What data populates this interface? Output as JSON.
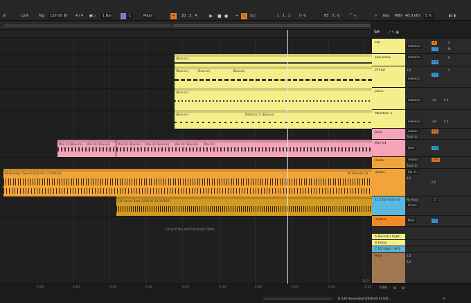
{
  "transport": {
    "link": "Link",
    "tap": "Tap",
    "tempo": "120.00",
    "signature": "4 / 4",
    "quantize": "1 Bar",
    "key": "C",
    "scale": "Major",
    "bar_pos": "20 .  3 .  4",
    "loop_start": "1 .  1 .  1",
    "loop_len": "65 .  3 .  0",
    "key_label": "Key",
    "sample_rate": "48.0 kHz",
    "cpu": "5 %",
    "midi": "MIDI"
  },
  "ruler": {
    "times": [
      "0:05",
      "0:10",
      "0:15",
      "0:20",
      "0:25",
      "0:30",
      "0:35",
      "0:40",
      "0:45",
      "0:50"
    ],
    "set_label": "Set"
  },
  "clips": {
    "bounce": "(Bounce)",
    "mellotron": "Mellotron V (Bounce)",
    "mini_v4": "Mini V4 (Bounce)",
    "mini_v4_short": "Mini V4 (",
    "brooklyn": "80 Brooklyn Taped [2026-05-13 014014]",
    "brooklyn_short": "80 Brooklyn Ta",
    "house_beat": "120 House Beat [2026-05-13 003853]",
    "drop_hint": "Drop Files and Devices Here",
    "page": "1/2"
  },
  "tracks": [
    {
      "name": "arp",
      "color": "#f4ef8a",
      "route": "melodics",
      "vol": "-1",
      "pan": "7.7"
    },
    {
      "name": "saw piano",
      "color": "#f4ef8a",
      "route": "melodics",
      "vol": "-1",
      "pan": "9.9"
    },
    {
      "name": "strings",
      "color": "#f4ef8a",
      "route": "melodics",
      "vol": "1/2",
      "pan": "5.2"
    },
    {
      "name": "piano",
      "color": "#f4ef8a",
      "route": "melodics",
      "vol": "-inf",
      "pan": "0.0"
    },
    {
      "name": "Mellotron V",
      "color": "#f4ef8a",
      "route": "melodics",
      "vol": "-inf",
      "pan": "0.0"
    },
    {
      "name": "bass",
      "color": "#f5a3b8",
      "route": "mixbus",
      "input": "Track In",
      "pan": "5.6"
    },
    {
      "name": "Mini V4",
      "color": "#f5a3b8",
      "route": "bass",
      "input": "",
      "pan": "3.3"
    },
    {
      "name": "drums",
      "color": "#f2a43a",
      "route": "mixbus",
      "input": "Track In",
      "pan": "-4.8"
    },
    {
      "name": "drums",
      "color": "#f2a43a",
      "route": "Ext. In",
      "input": "1/2",
      "pan": "0.0"
    },
    {
      "name": "11 120 House B",
      "color": "#5ab8e0",
      "route": "drums",
      "input": "No Input",
      "pan": "11"
    },
    {
      "name": "mixbus",
      "color": "#f08a24",
      "route": "Main",
      "input": "",
      "pan": "12"
    }
  ],
  "returns": [
    {
      "name": "A Reverb | Hybri",
      "color": "#f4ef8a"
    },
    {
      "name": "B Delay",
      "color": "#f4ef8a"
    },
    {
      "name": "C EQ Eight | M-S",
      "color": "#5ab8e0"
    }
  ],
  "main": {
    "name": "Main",
    "out_a": "1/2",
    "out_b": "1/2"
  },
  "status": {
    "zoom": "0.00s",
    "clip_name": "11-120 House Beat [2026-05-13 003...",
    "solo": "S",
    "mute": "M",
    "w": "W",
    "h": "H"
  }
}
